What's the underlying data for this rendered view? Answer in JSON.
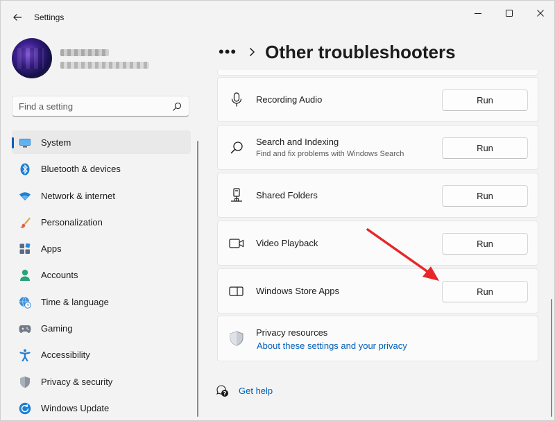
{
  "window": {
    "title": "Settings"
  },
  "search": {
    "placeholder": "Find a setting"
  },
  "sidebar": {
    "items": [
      {
        "label": "System",
        "icon": "monitor-icon",
        "selected": true
      },
      {
        "label": "Bluetooth & devices",
        "icon": "bluetooth-icon"
      },
      {
        "label": "Network & internet",
        "icon": "wifi-icon"
      },
      {
        "label": "Personalization",
        "icon": "brush-icon"
      },
      {
        "label": "Apps",
        "icon": "apps-icon"
      },
      {
        "label": "Accounts",
        "icon": "person-icon"
      },
      {
        "label": "Time & language",
        "icon": "globe-clock-icon"
      },
      {
        "label": "Gaming",
        "icon": "gamepad-icon"
      },
      {
        "label": "Accessibility",
        "icon": "accessibility-icon"
      },
      {
        "label": "Privacy & security",
        "icon": "shield-icon"
      },
      {
        "label": "Windows Update",
        "icon": "update-icon"
      }
    ]
  },
  "breadcrumb": {
    "ellipsis": "•••",
    "title": "Other troubleshooters"
  },
  "troubleshooters": [
    {
      "title": "Recording Audio",
      "subtitle": "",
      "icon": "microphone-icon",
      "run_label": "Run"
    },
    {
      "title": "Search and Indexing",
      "subtitle": "Find and fix problems with Windows Search",
      "icon": "search-icon",
      "run_label": "Run"
    },
    {
      "title": "Shared Folders",
      "subtitle": "",
      "icon": "network-drive-icon",
      "run_label": "Run"
    },
    {
      "title": "Video Playback",
      "subtitle": "",
      "icon": "video-camera-icon",
      "run_label": "Run"
    },
    {
      "title": "Windows Store Apps",
      "subtitle": "",
      "icon": "store-app-icon",
      "run_label": "Run"
    }
  ],
  "privacy": {
    "title": "Privacy resources",
    "link": "About these settings and your privacy"
  },
  "help": {
    "label": "Get help"
  },
  "colors": {
    "accent": "#005fb8",
    "annotation_arrow": "#e8262a"
  }
}
